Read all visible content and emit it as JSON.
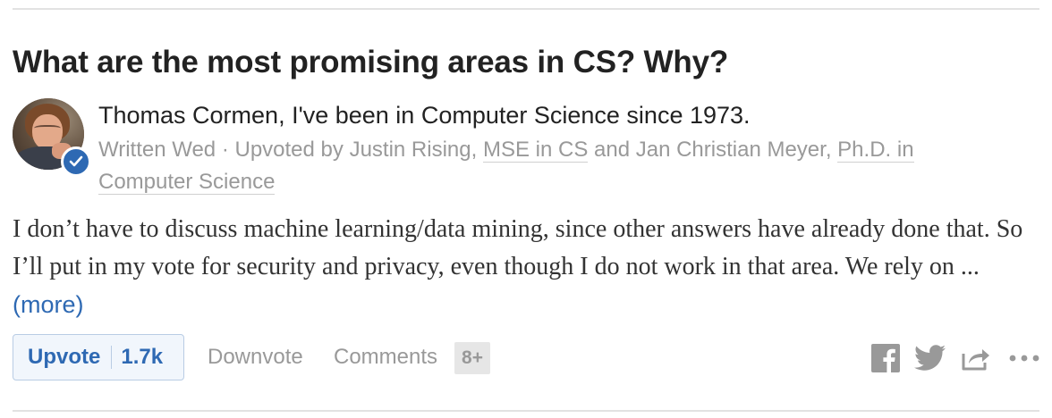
{
  "question": {
    "title": "What are the most promising areas in CS? Why?"
  },
  "author": {
    "name_credential": "Thomas Cormen, I've been in Computer Science since 1973.",
    "avatar_alt": "Thomas Cormen avatar"
  },
  "meta": {
    "written": "Written Wed",
    "separator": " · ",
    "upvoted_by": "Upvoted by ",
    "upvoter1_name": "Justin Rising",
    "upvoter1_cred": "MSE in CS",
    "and": " and ",
    "upvoter2_name": "Jan Christian Meyer",
    "upvoter2_cred": "Ph.D. in Computer Science",
    "comma": ", "
  },
  "answer": {
    "text": "I don’t have to discuss machine learning/data mining, since other answers have already done that. So I’ll put in my vote for security and privacy, even though I do not work in that area. We rely on ... ",
    "more_label": "(more)"
  },
  "actions": {
    "upvote_label": "Upvote",
    "upvote_count": "1.7k",
    "downvote_label": "Downvote",
    "comments_label": "Comments",
    "comments_count": "8+"
  },
  "icons": [
    "verified-check-icon",
    "facebook-icon",
    "twitter-icon",
    "share-icon",
    "more-options-icon"
  ],
  "colors": {
    "accent": "#2e69b3",
    "muted": "#999999",
    "title": "#222222",
    "upvote_bg": "#f1f6fc",
    "upvote_border": "#b9cce4"
  }
}
